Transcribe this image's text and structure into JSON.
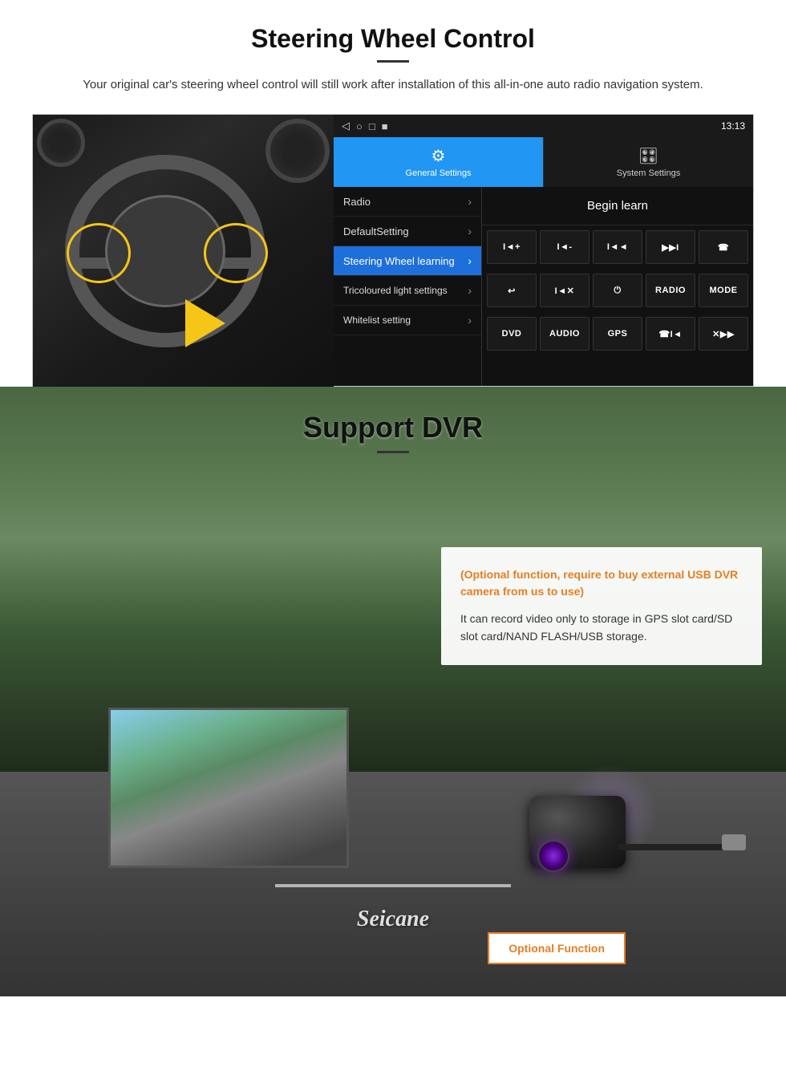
{
  "steering": {
    "title": "Steering Wheel Control",
    "description": "Your original car's steering wheel control will still work after installation of this all-in-one auto radio navigation system.",
    "statusbar": {
      "time": "13:13",
      "icons": [
        "◁",
        "○",
        "□",
        "■"
      ]
    },
    "menu": {
      "general_settings": "General Settings",
      "system_settings": "System Settings"
    },
    "sidebar": [
      {
        "label": "Radio",
        "active": false
      },
      {
        "label": "DefaultSetting",
        "active": false
      },
      {
        "label": "Steering Wheel learning",
        "active": true
      },
      {
        "label": "Tricoloured light settings",
        "active": false
      },
      {
        "label": "Whitelist setting",
        "active": false
      }
    ],
    "begin_learn": "Begin learn",
    "controls": {
      "row1": [
        "I◄+",
        "I◄-",
        "I◄◄",
        "▶▶I",
        "☎"
      ],
      "row2": [
        "↩",
        "I◄✕",
        "⏻",
        "RADIO",
        "MODE"
      ],
      "row3": [
        "DVD",
        "AUDIO",
        "GPS",
        "☎I◄",
        "✕▶▶"
      ]
    }
  },
  "dvr": {
    "title": "Support DVR",
    "optional_text": "(Optional function, require to buy external USB DVR camera from us to use)",
    "description": "It can record video only to storage in GPS slot card/SD slot card/NAND FLASH/USB storage.",
    "optional_button": "Optional Function",
    "logo": "Seicane"
  }
}
